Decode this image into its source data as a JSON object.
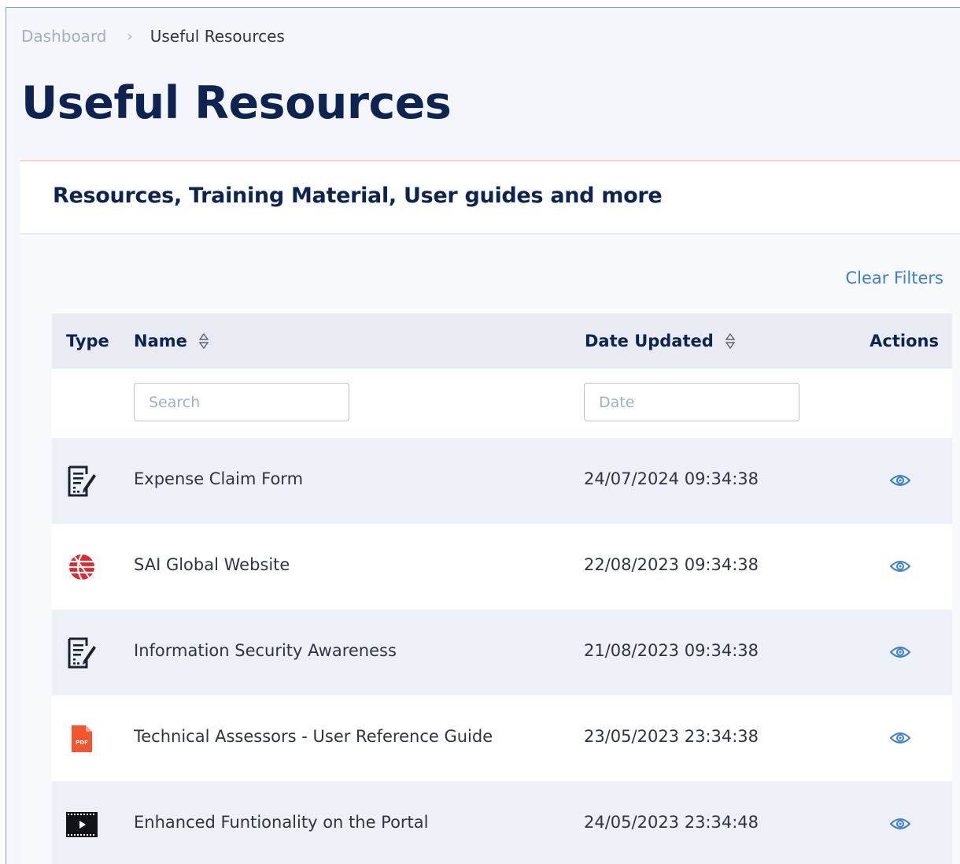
{
  "breadcrumb": {
    "dashboard": "Dashboard",
    "separator": "›",
    "current": "Useful Resources"
  },
  "page_title": "Useful Resources",
  "card": {
    "title": "Resources, Training Material, User guides and more",
    "clear_filters": "Clear Filters"
  },
  "table": {
    "columns": {
      "type": "Type",
      "name": "Name",
      "date": "Date Updated",
      "actions": "Actions"
    },
    "filters": {
      "name_placeholder": "Search",
      "date_placeholder": "Date"
    },
    "rows": [
      {
        "type_icon": "document-edit-icon",
        "name": "Expense Claim Form",
        "date": "24/07/2024 09:34:38",
        "action_icon": "eye-icon"
      },
      {
        "type_icon": "globe-website-icon",
        "name": "SAI Global Website",
        "date": "22/08/2023 09:34:38",
        "action_icon": "eye-icon"
      },
      {
        "type_icon": "document-edit-icon",
        "name": "Information Security Awareness",
        "date": "21/08/2023 09:34:38",
        "action_icon": "eye-icon"
      },
      {
        "type_icon": "pdf-file-icon",
        "name": "Technical Assessors - User Reference Guide",
        "date": "23/05/2023 23:34:38",
        "action_icon": "eye-icon"
      },
      {
        "type_icon": "video-film-icon",
        "name": "Enhanced Funtionality on the Portal",
        "date": "24/05/2023 23:34:48",
        "action_icon": "eye-icon"
      }
    ]
  },
  "colors": {
    "title_navy": "#0d2452",
    "link_blue": "#3b7fce",
    "pdf_orange": "#f4552c",
    "globe_red": "#e3262e"
  }
}
